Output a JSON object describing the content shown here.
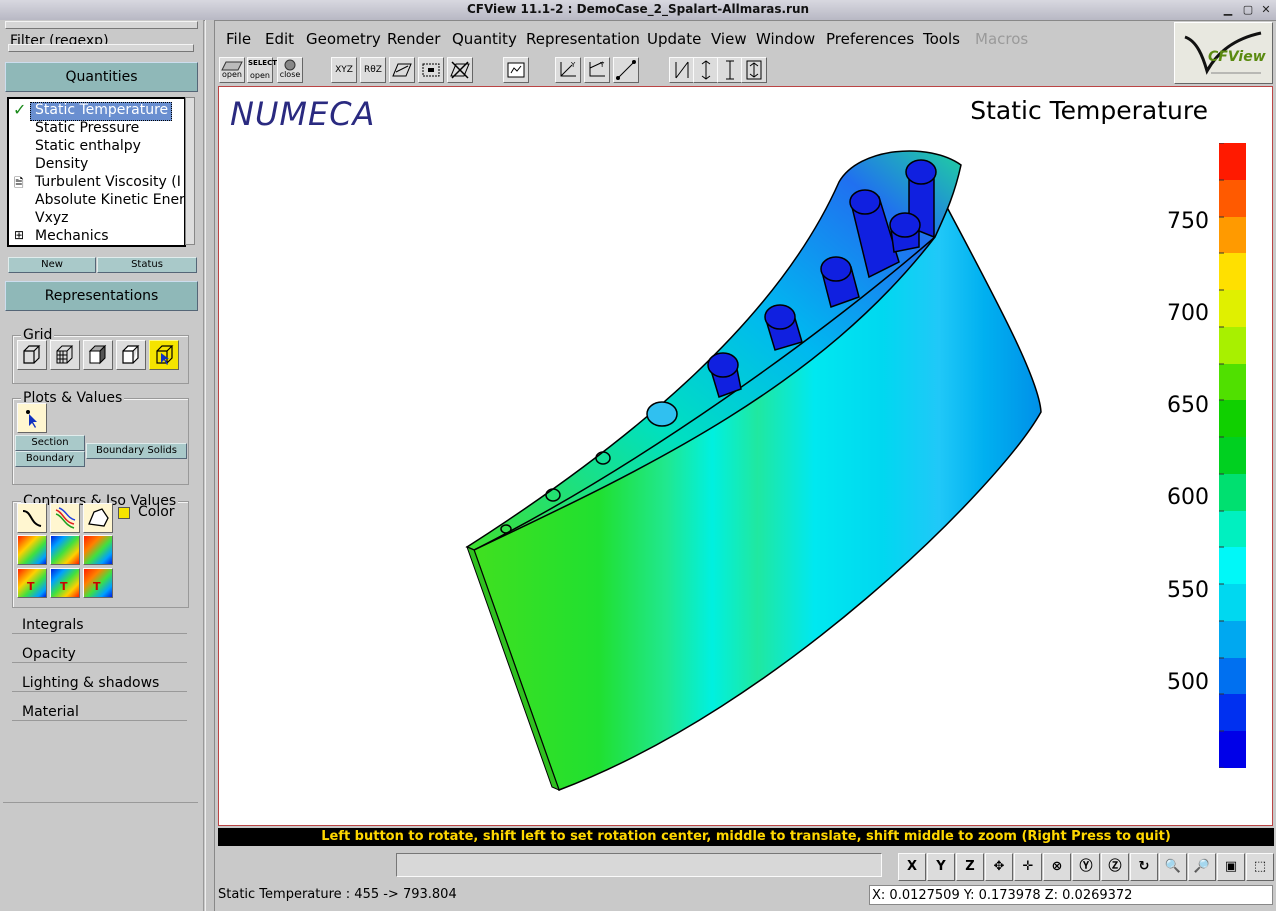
{
  "window": {
    "title": "CFView 11.1-2 : DemoCase_2_Spalart-Allmaras.run"
  },
  "left": {
    "filter_label": "Filter (regexp)",
    "quantities_header": "Quantities",
    "quantities": [
      "Static Temperature",
      "Static Pressure",
      "Static enthalpy",
      "Density",
      "Turbulent Viscosity (I",
      "Absolute Kinetic Ener",
      "Vxyz",
      "Mechanics"
    ],
    "new_label": "New",
    "status_label": "Status",
    "representations_header": "Representations",
    "grid_label": "Grid",
    "plots_label": "Plots & Values",
    "section_label": "Section",
    "boundary_label": "Boundary",
    "boundary_solids_label": "Boundary Solids",
    "contours_label": "Contours & Iso Values",
    "color_label": "Color",
    "integrals_label": "Integrals",
    "opacity_label": "Opacity",
    "lighting_label": "Lighting & shadows",
    "material_label": "Material"
  },
  "menu": [
    "File",
    "Edit",
    "Geometry",
    "Render",
    "Quantity",
    "Representation",
    "Update",
    "View",
    "Window",
    "Preferences",
    "Tools",
    "Macros"
  ],
  "toolbar": {
    "open_label": "open",
    "select_label": "SELECT",
    "open2_label": "open",
    "close_label": "close",
    "xyz_label": "XYZ",
    "rqz_label": "RθZ"
  },
  "logo_text": "CFView",
  "viewport": {
    "brand": "NUMECA",
    "quantity_title": "Static Temperature",
    "colorbar": {
      "ticks": [
        "750",
        "700",
        "650",
        "600",
        "550",
        "500"
      ],
      "colors": [
        "#ff1a00",
        "#ff5a00",
        "#ff9a00",
        "#ffe000",
        "#e0f000",
        "#a8f000",
        "#50e000",
        "#10d000",
        "#00d020",
        "#00e070",
        "#00f0c0",
        "#00f8f8",
        "#00d8f0",
        "#00a8f0",
        "#0070f0",
        "#0030f0",
        "#0000e8"
      ]
    }
  },
  "status_message": "Left button to rotate, shift left to set rotation center, middle to translate, shift middle to zoom (Right Press to quit)",
  "nav_buttons": [
    "X",
    "Y",
    "Z"
  ],
  "bottom": {
    "range_text": "Static Temperature :  455  ->  793.804",
    "coords": "X: 0.0127509   Y: 0.173978   Z: 0.0269372"
  }
}
